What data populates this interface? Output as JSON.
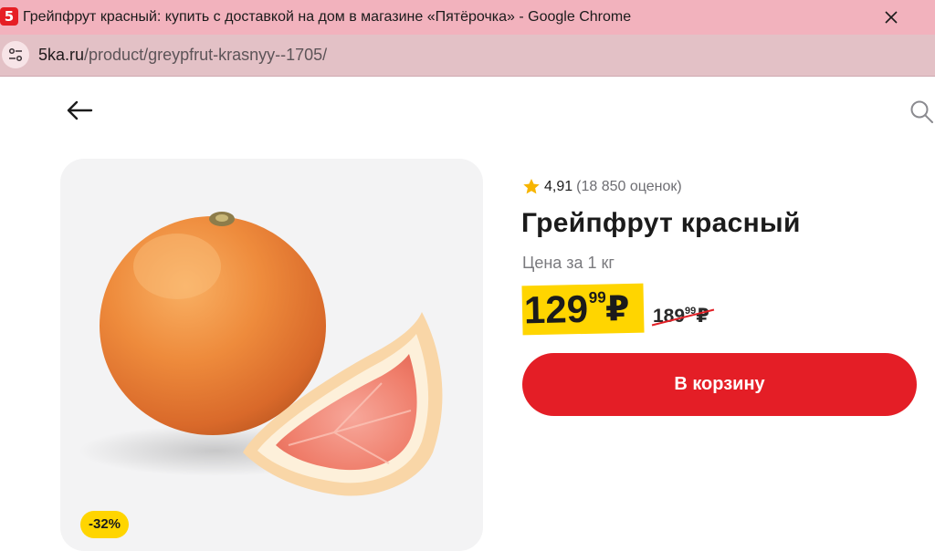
{
  "browser": {
    "favicon_text": "5",
    "window_title": "Грейпфрут красный: купить с доставкой на дом в магазине «Пятёрочка» - Google Chrome",
    "url_host": "5ka.ru",
    "url_path": "/product/greypfrut-krasnyy--1705/"
  },
  "product": {
    "rating_value": "4,91",
    "rating_count": "(18 850 оценок)",
    "title": "Грейпфрут красный",
    "unit_label": "Цена за 1 кг",
    "price_int": "129",
    "price_kop": "99",
    "currency": "₽",
    "old_price_int": "189",
    "old_price_kop": "99",
    "discount": "-32%",
    "cart_button_label": "В корзину"
  },
  "colors": {
    "title_bar": "#f2b2bd",
    "address_bar": "#e3c1c6",
    "brand_red": "#e41e26",
    "price_yellow": "#ffd500",
    "star": "#f7b500"
  },
  "icons": [
    "favicon-5",
    "close-icon",
    "site-info-icon",
    "back-arrow-icon",
    "search-icon",
    "star-icon"
  ]
}
